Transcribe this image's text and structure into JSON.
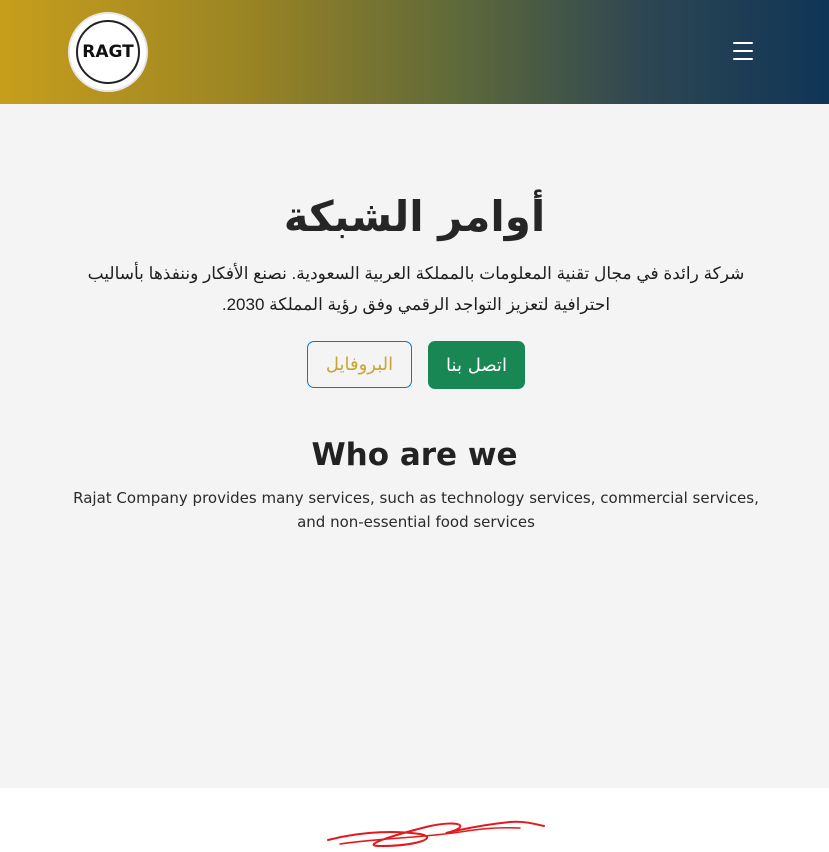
{
  "header": {
    "logo_text": "RAGT",
    "colors": {
      "gradient_start": "#c79e1c",
      "gradient_end": "#0f3556"
    },
    "menu_icon": "hamburger-icon"
  },
  "hero": {
    "title": "أوامر الشبكة",
    "description": "شركة رائدة في مجال تقنية المعلومات بالمملكة العربية السعودية. نصنع الأفكار وننفذها بأساليب احترافية لتعزيز التواجد الرقمي وفق رؤية المملكة 2030.",
    "contact_button": "اتصل بنا",
    "profile_button": "البروفايل",
    "colors": {
      "contact_bg": "#198754",
      "profile_text": "#caa433",
      "profile_border": "#1d6fc0"
    }
  },
  "about": {
    "title": "Who are we",
    "description": "Rajat Company provides many services, such as technology services, commercial services, and non-essential food services"
  }
}
